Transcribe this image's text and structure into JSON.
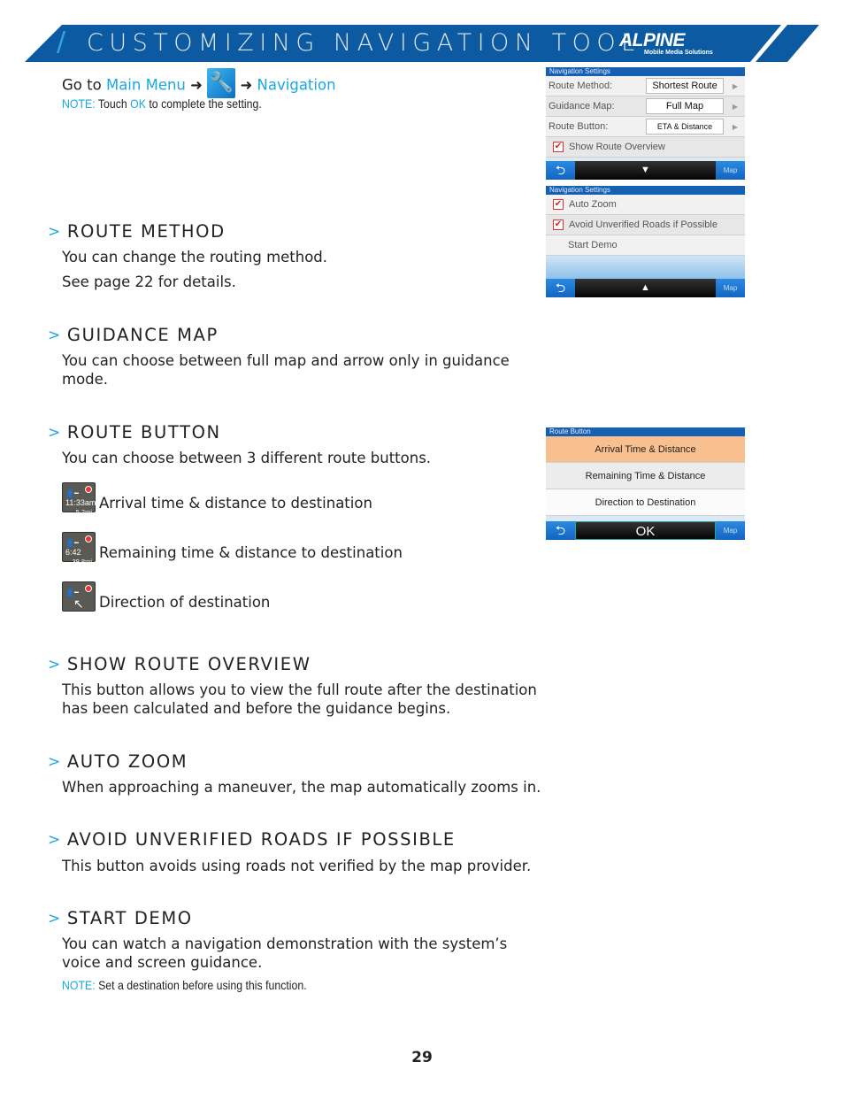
{
  "header": {
    "title": "CUSTOMIZING NAVIGATION TOOL",
    "brand": "ALPINE",
    "brand_tagline": "Mobile Media Solutions",
    "brand_color": "#0b5aa2"
  },
  "intro": {
    "go_to": "Go to",
    "main_menu": "Main Menu",
    "arrow": "➜",
    "navigation": "Navigation",
    "note_label": "NOTE:",
    "note_text1": "Touch",
    "note_ok": "OK",
    "note_text2": "to complete the setting."
  },
  "sections": [
    {
      "title": "ROUTE METHOD",
      "body": "You can change the routing method.",
      "body2": "See page 22 for details."
    },
    {
      "title": "GUIDANCE MAP",
      "body": "You can choose between full map and arrow only in guidance mode."
    },
    {
      "title": "ROUTE BUTTON",
      "body": "You can choose between 3 different route buttons.",
      "options": [
        {
          "label": "Arrival time & distance to destination",
          "icon_time": "11:33am",
          "icon_dist": "5.2mi"
        },
        {
          "label": "Remaining time & distance to destination",
          "icon_time": "6:42",
          "icon_dist": "39.8mi"
        },
        {
          "label": "Direction of destination"
        }
      ]
    },
    {
      "title": "SHOW ROUTE OVERVIEW",
      "body": "This button allows you to view the full route after the destination has been calculated and before the guidance begins."
    },
    {
      "title": "AUTO ZOOM",
      "body": "When approaching a maneuver, the map automatically zooms in."
    },
    {
      "title": "AVOID UNVERIFIED ROADS IF POSSIBLE",
      "body": "This button avoids using roads not verified by the map provider."
    },
    {
      "title": "START DEMO",
      "body": "You can watch a navigation demonstration with the system’s voice and screen guidance.",
      "note_label": "NOTE:",
      "note_text": "Set a destination before using this function."
    }
  ],
  "screen1": {
    "header": "Navigation Settings",
    "rows": [
      {
        "label": "Route Method:",
        "value": "Shortest Route"
      },
      {
        "label": "Guidance Map:",
        "value": "Full Map"
      },
      {
        "label": "Route Button:",
        "value": "ETA & Distance"
      }
    ],
    "check": "Show Route Overview",
    "map": "Map"
  },
  "screen2": {
    "header": "Navigation Settings",
    "checks": [
      "Auto Zoom",
      "Avoid Unverified Roads if Possible"
    ],
    "demo": "Start Demo",
    "map": "Map"
  },
  "screen3": {
    "header": "Route Button",
    "options": [
      "Arrival Time & Distance",
      "Remaining Time & Distance",
      "Direction to Destination"
    ],
    "selected": "Arrival Time & Distance",
    "ok": "OK",
    "map": "Map"
  },
  "page_number": "29"
}
